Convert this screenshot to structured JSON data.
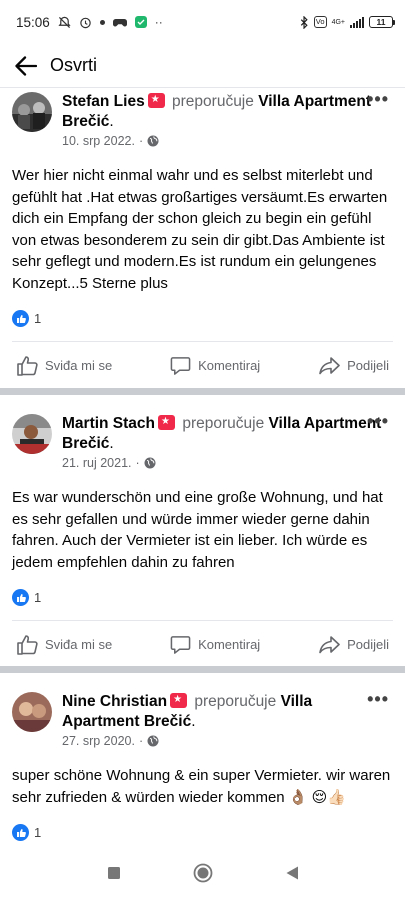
{
  "status_bar": {
    "time": "15:06",
    "battery": "11",
    "network": "4G+"
  },
  "header": {
    "title": "Osvrti"
  },
  "reviews": [
    {
      "name": "Stefan Lies",
      "verb": "preporučuje",
      "place": "Villa Apartment Brečić",
      "date": "10. srp 2022.",
      "text": "Wer hier nicht einmal wahr und es selbst miterlebt und gefühlt hat .Hat etwas großartiges versäumt.Es erwarten dich ein Empfang der schon gleich zu begin ein gefühl von etwas besonderem zu sein dir gibt.Das Ambiente ist sehr geflegt und modern.Es ist rundum ein gelungenes Konzept...5 Sterne plus",
      "likes": "1"
    },
    {
      "name": "Martin Stach",
      "verb": "preporučuje",
      "place": "Villa Apartment Brečić",
      "date": "21. ruj 2021.",
      "text": "Es war wunderschön und eine große Wohnung, und hat es sehr gefallen und würde immer wieder gerne dahin fahren. Auch der Vermieter ist ein lieber. Ich würde es jedem empfehlen dahin zu fahren",
      "likes": "1"
    },
    {
      "name": "Nine Christian",
      "verb": "preporučuje",
      "place": "Villa Apartment Brečić",
      "date": "27. srp 2020.",
      "text": "super schöne Wohnung & ein super Vermieter. wir waren sehr zufrieden & würden wieder kommen 👌🏽 😌👍🏻",
      "likes": "1"
    }
  ],
  "actions": {
    "like": "Sviđa mi se",
    "comment": "Komentiraj",
    "share": "Podijeli"
  },
  "colors": {
    "accent": "#1877f2",
    "recommend": "#f02849",
    "muted": "#65676b",
    "divider": "#c9ccd1"
  },
  "icons": [
    "back-arrow-icon",
    "recommend-star-icon",
    "globe-icon",
    "more-icon",
    "like-icon",
    "comment-icon",
    "share-icon"
  ]
}
